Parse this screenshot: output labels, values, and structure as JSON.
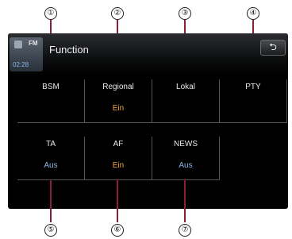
{
  "callouts": {
    "top": [
      "①",
      "②",
      "③",
      "④"
    ],
    "bottom": [
      "⑤",
      "⑥",
      "⑦"
    ]
  },
  "header": {
    "title": "Function",
    "source_badge": "FM",
    "clock": "02:28",
    "back_icon": "back-arrow-icon"
  },
  "functions": {
    "bsm": {
      "label": "BSM"
    },
    "regional": {
      "label": "Regional",
      "value": "Ein"
    },
    "lokal": {
      "label": "Lokal"
    },
    "pty": {
      "label": "PTY"
    },
    "ta": {
      "label": "TA",
      "value": "Aus"
    },
    "af": {
      "label": "AF",
      "value": "Ein"
    },
    "news": {
      "label": "NEWS",
      "value": "Aus"
    }
  },
  "colors": {
    "leader_line": "#8a2036",
    "value_on": "#f2a636",
    "value_off": "#8fb6e6"
  }
}
